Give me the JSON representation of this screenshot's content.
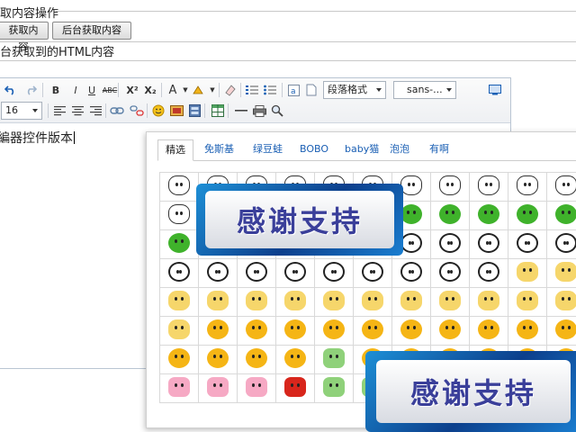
{
  "form": {
    "legend": "取内容操作",
    "get_content_button": "获取内容",
    "backend_get_button": "后台获取内容",
    "result_label": "台获取到的HTML内容"
  },
  "toolbar": {
    "row1": [
      {
        "name": "undo-icon"
      },
      {
        "name": "redo-icon"
      },
      {
        "name": "bold-icon",
        "label": "B"
      },
      {
        "name": "italic-icon",
        "label": "I"
      },
      {
        "name": "underline-icon",
        "label": "U"
      },
      {
        "name": "strikethrough-icon",
        "label": "ABC"
      },
      {
        "name": "superscript-icon",
        "label": "X²"
      },
      {
        "name": "subscript-icon",
        "label": "X₂"
      },
      {
        "name": "font-color-icon",
        "label": "A"
      },
      {
        "name": "highlight-icon"
      },
      {
        "name": "eraser-icon"
      },
      {
        "name": "ordered-list-icon"
      },
      {
        "name": "unordered-list-icon"
      },
      {
        "name": "text-box-icon"
      },
      {
        "name": "page-icon"
      },
      {
        "name": "preview-icon"
      }
    ],
    "paragraph_format": "段落格式",
    "font_family": "sans-...",
    "font_size": "16",
    "row2": [
      {
        "name": "align-left-icon"
      },
      {
        "name": "align-center-icon"
      },
      {
        "name": "align-right-icon"
      },
      {
        "name": "link-icon"
      },
      {
        "name": "unlink-icon"
      },
      {
        "name": "emoticon-icon"
      },
      {
        "name": "image-icon"
      },
      {
        "name": "media-icon"
      },
      {
        "name": "table-icon"
      },
      {
        "name": "horizontal-rule-icon"
      },
      {
        "name": "print-icon"
      },
      {
        "name": "search-icon"
      }
    ]
  },
  "editor": {
    "content": "編器控件版本"
  },
  "emotions": {
    "tabs": [
      "精选",
      "免斯基",
      "绿豆蛙",
      "BOBO",
      "baby猫",
      "泡泡",
      "有啊"
    ],
    "active_tab": 0,
    "rows": [
      [
        "rabbit",
        "rabbit",
        "rabbit",
        "rabbit",
        "rabbit",
        "rabbit",
        "rabbit",
        "rabbit",
        "rabbit",
        "rabbit",
        "rabbit"
      ],
      [
        "rabbit",
        "frog",
        "frog",
        "frog",
        "frog",
        "frog",
        "frog",
        "frog",
        "frog",
        "frog",
        "frog"
      ],
      [
        "frog",
        "frog",
        "frog",
        "frog",
        "frog",
        "frog",
        "panda",
        "panda",
        "panda",
        "panda",
        "panda"
      ],
      [
        "panda",
        "panda",
        "panda",
        "panda",
        "panda",
        "panda",
        "panda",
        "panda",
        "panda",
        "cat",
        "cat"
      ],
      [
        "cat",
        "cat",
        "cat",
        "cat",
        "cat",
        "cat",
        "cat",
        "cat",
        "cat",
        "cat",
        "cat"
      ],
      [
        "cat",
        "smile",
        "smile",
        "smile",
        "smile",
        "smile",
        "smile",
        "smile",
        "smile",
        "smile",
        "smile"
      ],
      [
        "smile",
        "smile",
        "smile",
        "smile",
        "green2",
        "smile",
        "smile",
        "smile",
        "smile",
        "smile",
        "smile"
      ],
      [
        "pink",
        "pink",
        "pink",
        "red",
        "green2",
        "green2",
        "green2",
        "green2",
        "green2",
        "green2",
        "green2"
      ]
    ]
  },
  "watermark": {
    "text1": "感谢支持",
    "text2": "感谢支持"
  },
  "colors": {
    "accent": "#1a5fb4",
    "banner_blue": "#0c3f8c",
    "banner_text": "#3a3f9a"
  }
}
